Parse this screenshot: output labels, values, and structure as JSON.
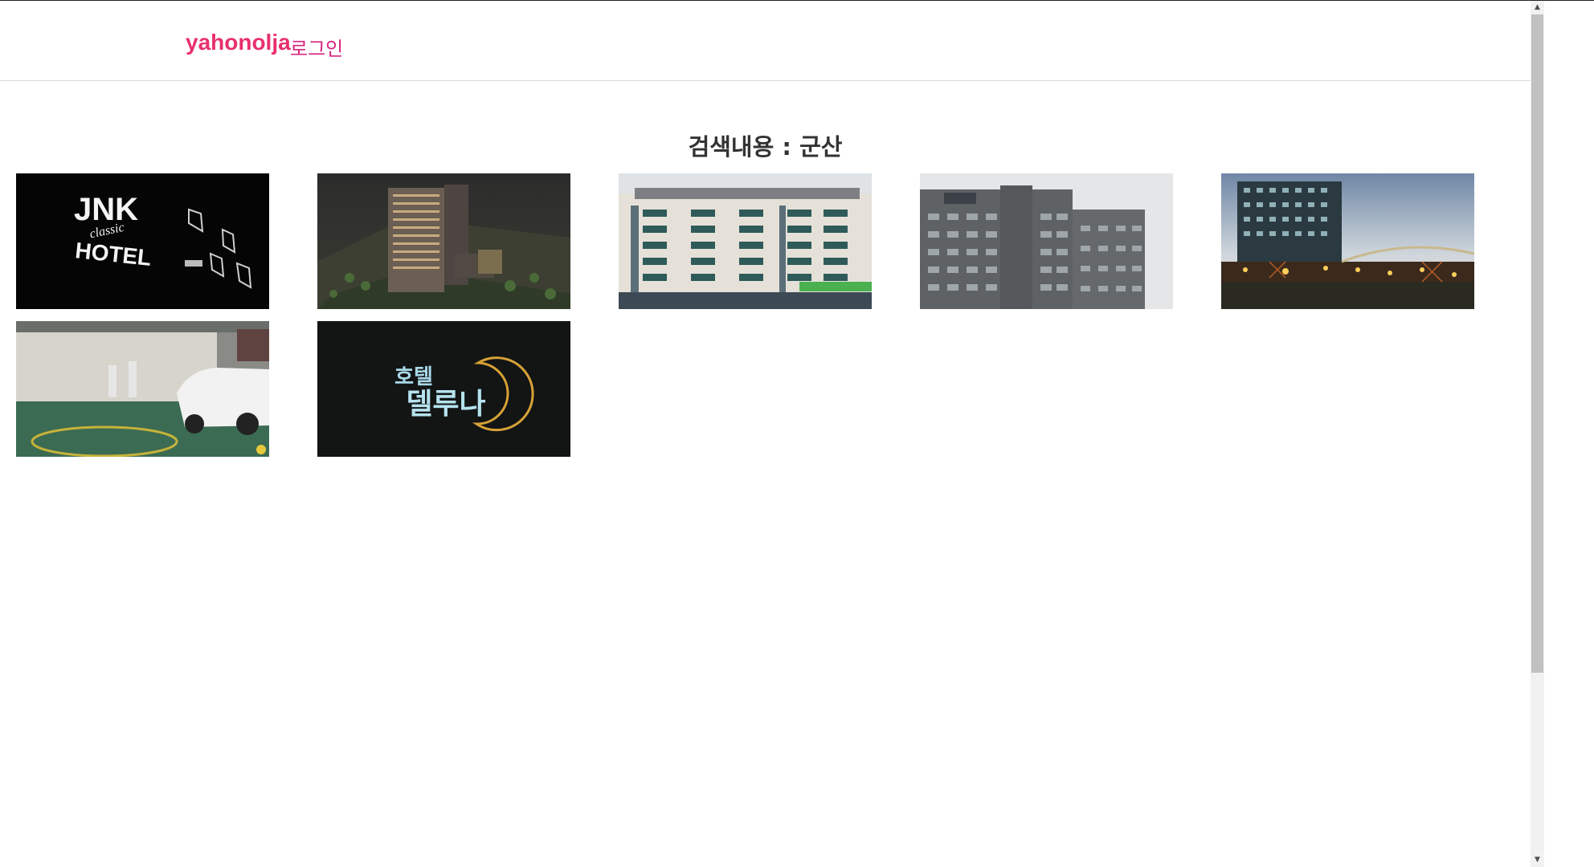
{
  "colors": {
    "accent": "#e8306d",
    "link": "#d6247f"
  },
  "header": {
    "brand": "yahonolja",
    "login": "로그인"
  },
  "search": {
    "title": "검색내용 : 군산"
  },
  "results": [
    {
      "name": "hotel-card-1",
      "image": "jnk-classic-hotel-sign",
      "sign_text": [
        "JNK",
        "classic",
        "HOTEL"
      ]
    },
    {
      "name": "hotel-card-2",
      "image": "night-aerial-hotel-tower"
    },
    {
      "name": "hotel-card-3",
      "image": "beige-hotel-facade"
    },
    {
      "name": "hotel-card-4",
      "image": "grey-stone-hotel-building"
    },
    {
      "name": "hotel-card-5",
      "image": "lit-hotel-at-dusk"
    },
    {
      "name": "hotel-card-6",
      "image": "parking-garage-white-car"
    },
    {
      "name": "hotel-card-7",
      "image": "hotel-luna-neon-sign",
      "sign_text": [
        "호텔",
        "델루나"
      ]
    }
  ],
  "scrollbar": {
    "up_icon": "▲",
    "down_icon": "▼",
    "position": 0
  }
}
